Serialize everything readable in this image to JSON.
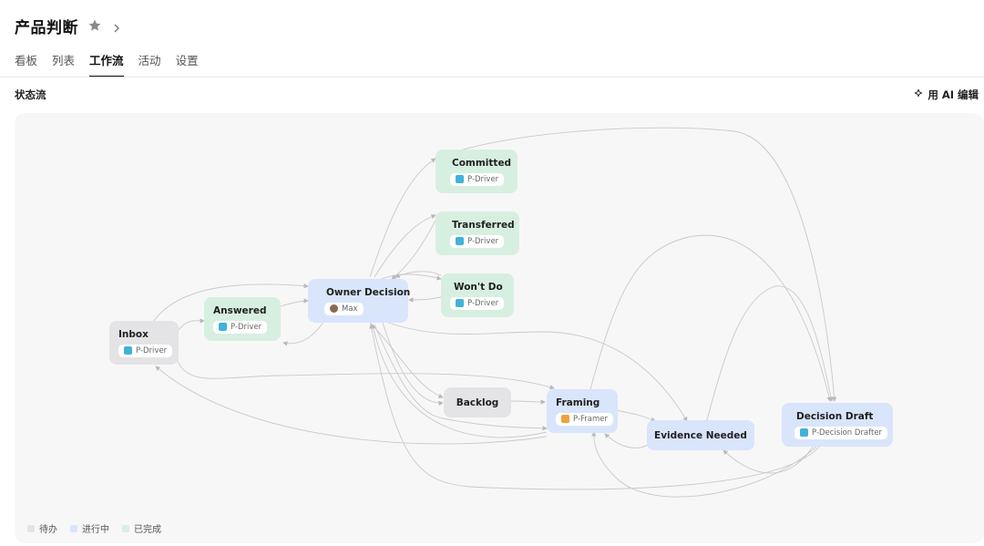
{
  "header": {
    "title": "产品判断"
  },
  "tabs": [
    {
      "label": "看板",
      "active": false
    },
    {
      "label": "列表",
      "active": false
    },
    {
      "label": "工作流",
      "active": true
    },
    {
      "label": "活动",
      "active": false
    },
    {
      "label": "设置",
      "active": false
    }
  ],
  "section": {
    "title": "状态流",
    "ai_edit_label": "用 AI 编辑"
  },
  "colors": {
    "todo": "#e4e4e6",
    "in_progress": "#d9e5fb",
    "done": "#d7efe1",
    "edge": "#c6c6c9"
  },
  "nodes": {
    "inbox": {
      "label": "Inbox",
      "owner": "P-Driver",
      "status": "todo"
    },
    "answered": {
      "label": "Answered",
      "owner": "P-Driver",
      "status": "done"
    },
    "owner_decision": {
      "label": "Owner Decision",
      "owner": "Max",
      "status": "in_progress"
    },
    "committed": {
      "label": "Committed",
      "owner": "P-Driver",
      "status": "done"
    },
    "transferred": {
      "label": "Transferred",
      "owner": "P-Driver",
      "status": "done"
    },
    "wont_do": {
      "label": "Won't Do",
      "owner": "P-Driver",
      "status": "done"
    },
    "backlog": {
      "label": "Backlog",
      "status": "todo"
    },
    "framing": {
      "label": "Framing",
      "owner": "P-Framer",
      "status": "in_progress"
    },
    "evidence_needed": {
      "label": "Evidence Needed",
      "status": "in_progress"
    },
    "decision_draft": {
      "label": "Decision Draft",
      "owner": "P-Decision Drafter",
      "status": "in_progress"
    }
  },
  "legend": [
    {
      "label": "待办",
      "color": "#e4e4e6"
    },
    {
      "label": "进行中",
      "color": "#d9e5fb"
    },
    {
      "label": "已完成",
      "color": "#d7efe1"
    }
  ]
}
